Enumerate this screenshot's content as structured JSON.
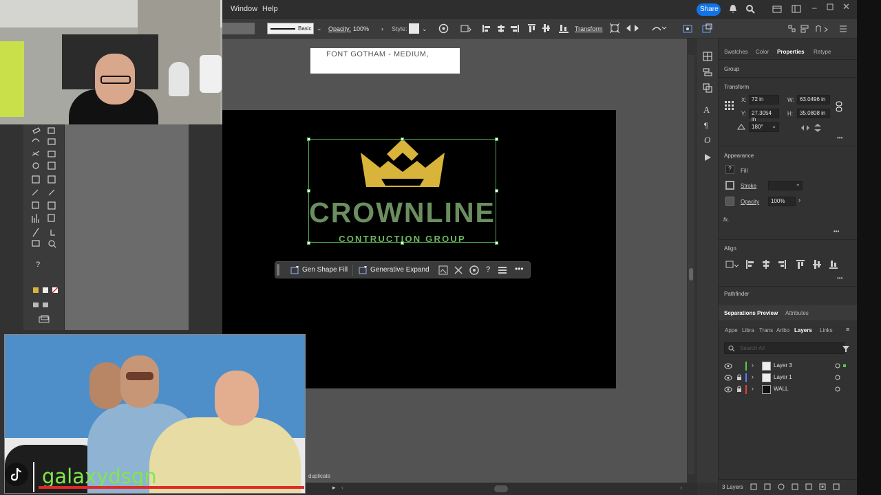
{
  "menu": {
    "window": "Window",
    "help": "Help"
  },
  "topbar": {
    "share_label": "Share"
  },
  "control_bar": {
    "stroke_profile": "Basic",
    "opacity_label": "Opacity:",
    "opacity_value": "100%",
    "style_label": "Style:",
    "transform_label": "Transform"
  },
  "canvas": {
    "note_text": "FONT GOTHAM - MEDIUM,",
    "logo_title": "CROWNLINE",
    "logo_subtitle": "CONTRUCTION GROUP",
    "crown_color": "#d9b43a",
    "title_color": "#6b8e5f",
    "subtitle_color": "#6dbb5f"
  },
  "context_bar": {
    "gen_shape_fill": "Gen Shape Fill",
    "generative_expand": "Generative Expand"
  },
  "properties_panel": {
    "tabs": [
      "Swatches",
      "Color",
      "Properties",
      "Retype"
    ],
    "active_tab": "Properties",
    "object_type": "Group",
    "transform_title": "Transform",
    "x_label": "X:",
    "x_value": "72 in",
    "y_label": "Y:",
    "y_value": "27.3054 in",
    "w_label": "W:",
    "w_value": "63.0496 in",
    "h_label": "H:",
    "h_value": "35.0808 in",
    "rotation_value": "180°",
    "appearance_title": "Appearance",
    "fill_label": "Fill",
    "stroke_label": "Stroke",
    "opacity_label": "Opacity",
    "opacity_value": "100%",
    "fx_label": "fx.",
    "align_title": "Align",
    "pathfinder_title": "Pathfinder"
  },
  "layers_panel": {
    "top_tabs": [
      "Separations Preview",
      "Attributes"
    ],
    "tabs": [
      "Appe",
      "Libra",
      "Trans",
      "Artbo",
      "Layers",
      "Links"
    ],
    "active_tab": "Layers",
    "search_placeholder": "Search All",
    "layers": [
      {
        "name": "Layer 3",
        "color": "#4cd14c"
      },
      {
        "name": "Layer 1",
        "color": "#5a7bff"
      },
      {
        "name": "WALL",
        "color": "#e04040"
      }
    ],
    "count_label": "3 Layers"
  },
  "status": {
    "last_action": "duplicate"
  },
  "overlay": {
    "handle": "galaxydsgn"
  }
}
